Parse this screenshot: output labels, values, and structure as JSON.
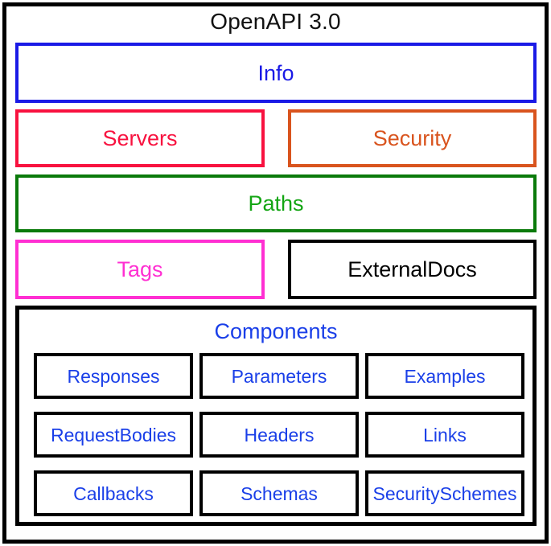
{
  "diagram": {
    "title": "OpenAPI 3.0",
    "title_color": "#111111",
    "frame_color": "#000000",
    "background": "#ffffff",
    "sections": [
      {
        "id": "info",
        "label": "Info",
        "color": "#1a1ae6"
      },
      {
        "id": "servers",
        "label": "Servers",
        "color": "#f8123f"
      },
      {
        "id": "security",
        "label": "Security",
        "color": "#d9541e"
      },
      {
        "id": "paths",
        "label": "Paths",
        "text_color": "#13a513",
        "color": "#0a7a0a"
      },
      {
        "id": "tags",
        "label": "Tags",
        "color": "#ff2fd2"
      },
      {
        "id": "externaldocs",
        "label": "ExternalDocs",
        "color": "#000000"
      }
    ],
    "components": {
      "label": "Components",
      "label_color": "#1a3fe8",
      "border_color": "#000000",
      "item_border_color": "#000000",
      "item_text_color": "#1a3fe8",
      "items": [
        {
          "id": "responses",
          "label": "Responses"
        },
        {
          "id": "parameters",
          "label": "Parameters"
        },
        {
          "id": "examples",
          "label": "Examples"
        },
        {
          "id": "requestbodies",
          "label": "RequestBodies"
        },
        {
          "id": "headers",
          "label": "Headers"
        },
        {
          "id": "links",
          "label": "Links"
        },
        {
          "id": "callbacks",
          "label": "Callbacks"
        },
        {
          "id": "schemas",
          "label": "Schemas"
        },
        {
          "id": "securityschemes",
          "label": "SecuritySchemes"
        }
      ]
    }
  }
}
